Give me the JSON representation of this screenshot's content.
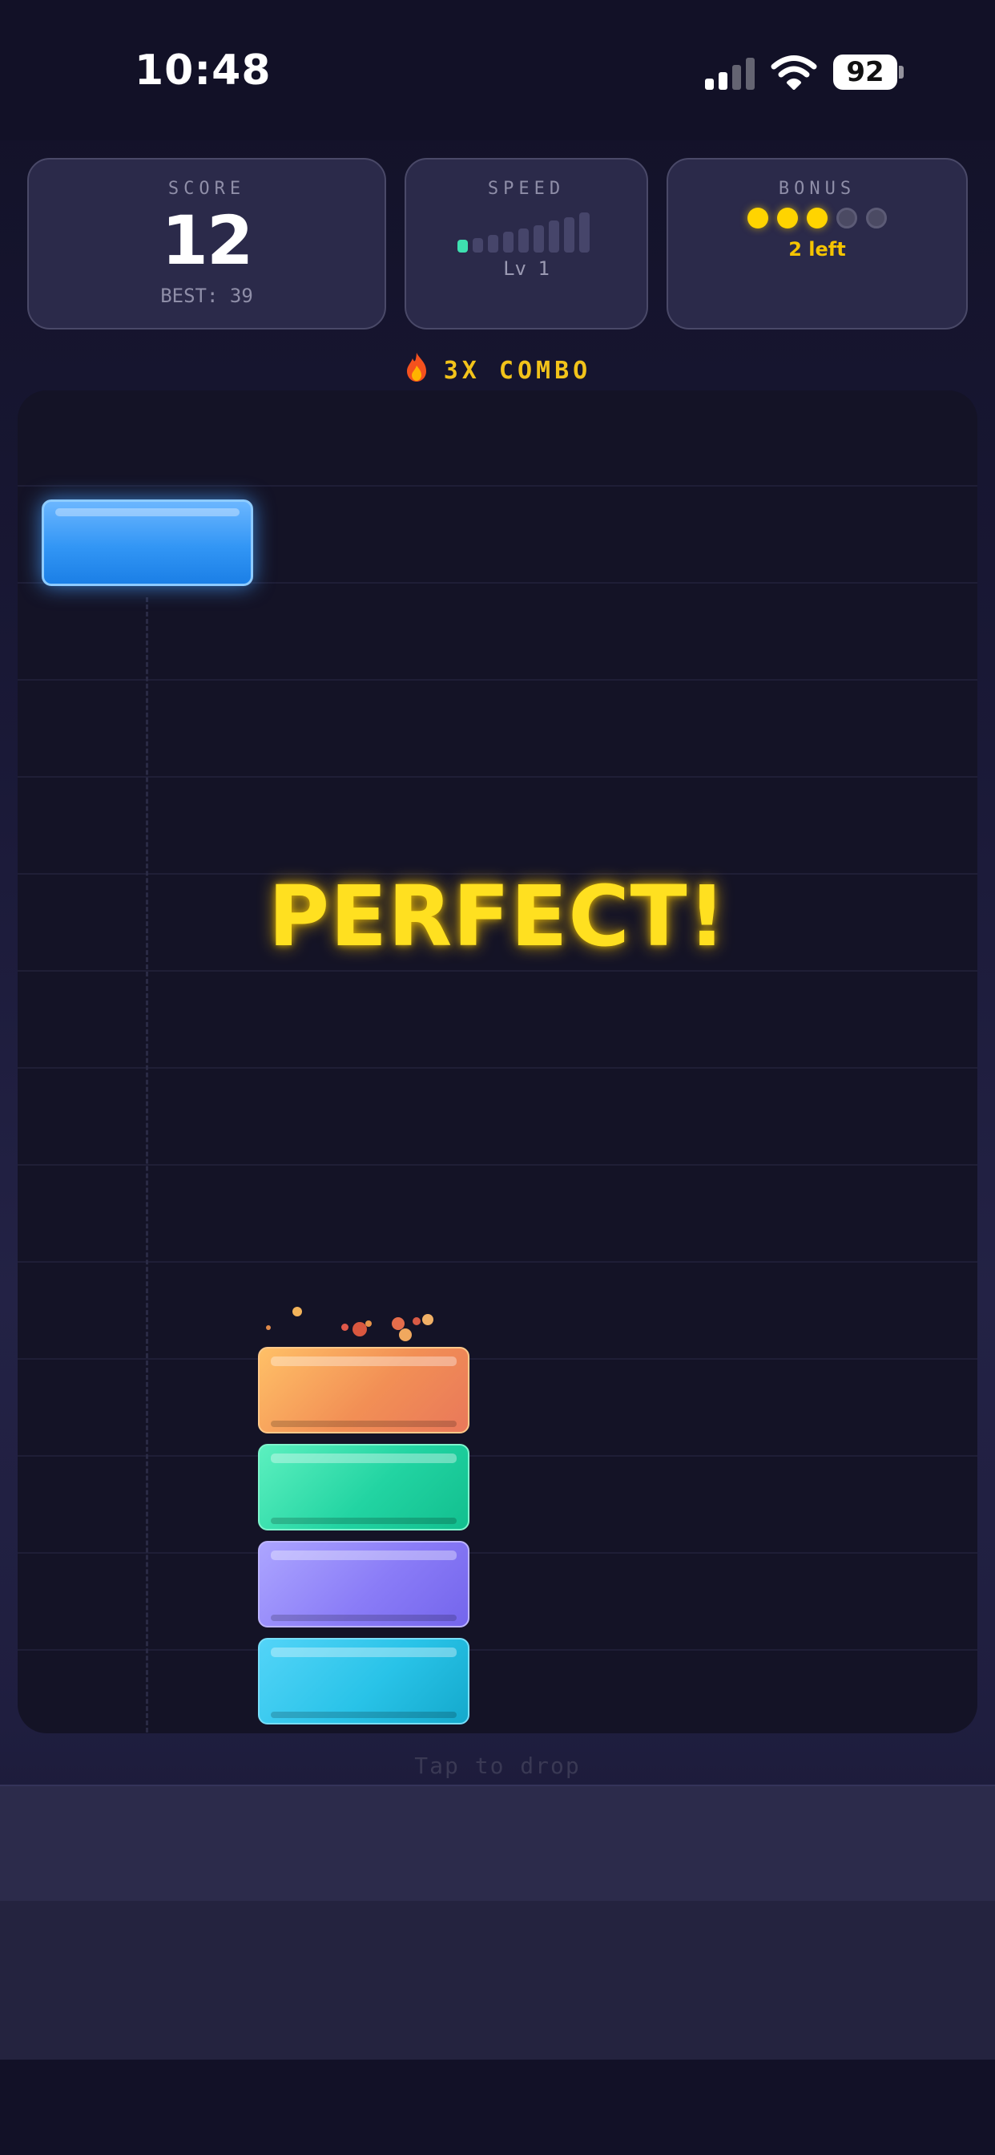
{
  "status_bar": {
    "time": "10:48",
    "battery": "92"
  },
  "score_card": {
    "title": "SCORE",
    "value": "12",
    "best": "BEST: 39"
  },
  "speed_card": {
    "title": "SPEED",
    "level": "Lv 1",
    "active_bars": 1,
    "total_bars": 9
  },
  "bonus_card": {
    "title": "BONUS",
    "filled": 3,
    "total": 5,
    "remaining": "2 left"
  },
  "combo": {
    "label": "3X COMBO"
  },
  "board": {
    "message": "PERFECT!"
  },
  "stack_colors": [
    "#ff9f5a",
    "#2fd9a8",
    "#8a7cf7",
    "#29c3e8"
  ],
  "falling_block_color": "#3296f5",
  "hint": "Tap to drop"
}
